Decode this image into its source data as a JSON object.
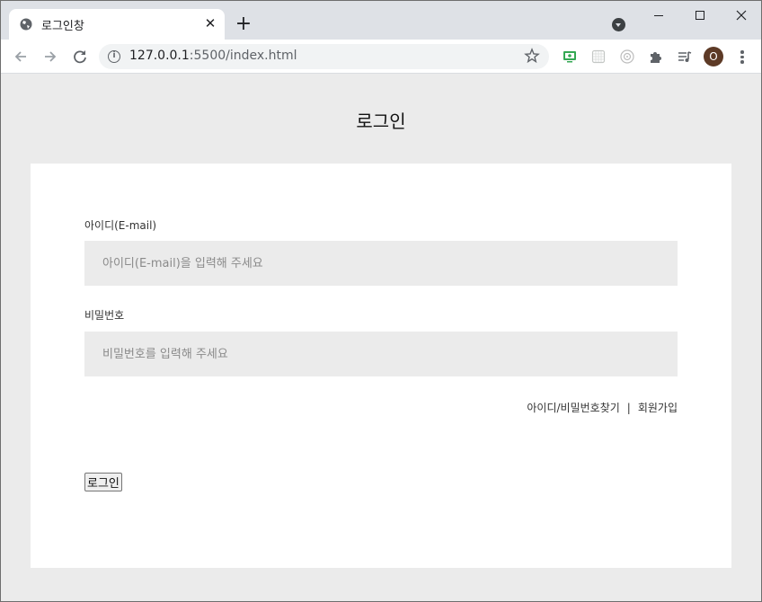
{
  "browser": {
    "tab_title": "로그인창",
    "tab_close_glyph": "✕",
    "new_tab_glyph": "+",
    "url_host": "127.0.0.1",
    "url_port_path": ":5500/index.html",
    "profile_initial": "O",
    "icons": [
      "globe-icon",
      "back-icon",
      "forward-icon",
      "reload-icon",
      "info-icon",
      "star-icon",
      "screen-ext-icon",
      "grid-ext-icon",
      "camera-ext-icon",
      "puzzle-icon",
      "media-icon",
      "more-icon"
    ],
    "accent_green": "#34a853"
  },
  "page": {
    "title": "로그인",
    "id_label": "아이디(E-mail)",
    "id_placeholder": "아이디(E-mail)을 입력해 주세요",
    "pw_label": "비밀번호",
    "pw_placeholder": "비밀번호를 입력해 주세요",
    "find_link": "아이디/비밀번호찾기",
    "separator": "|",
    "signup_link": "회원가입",
    "login_button": "로그인"
  }
}
